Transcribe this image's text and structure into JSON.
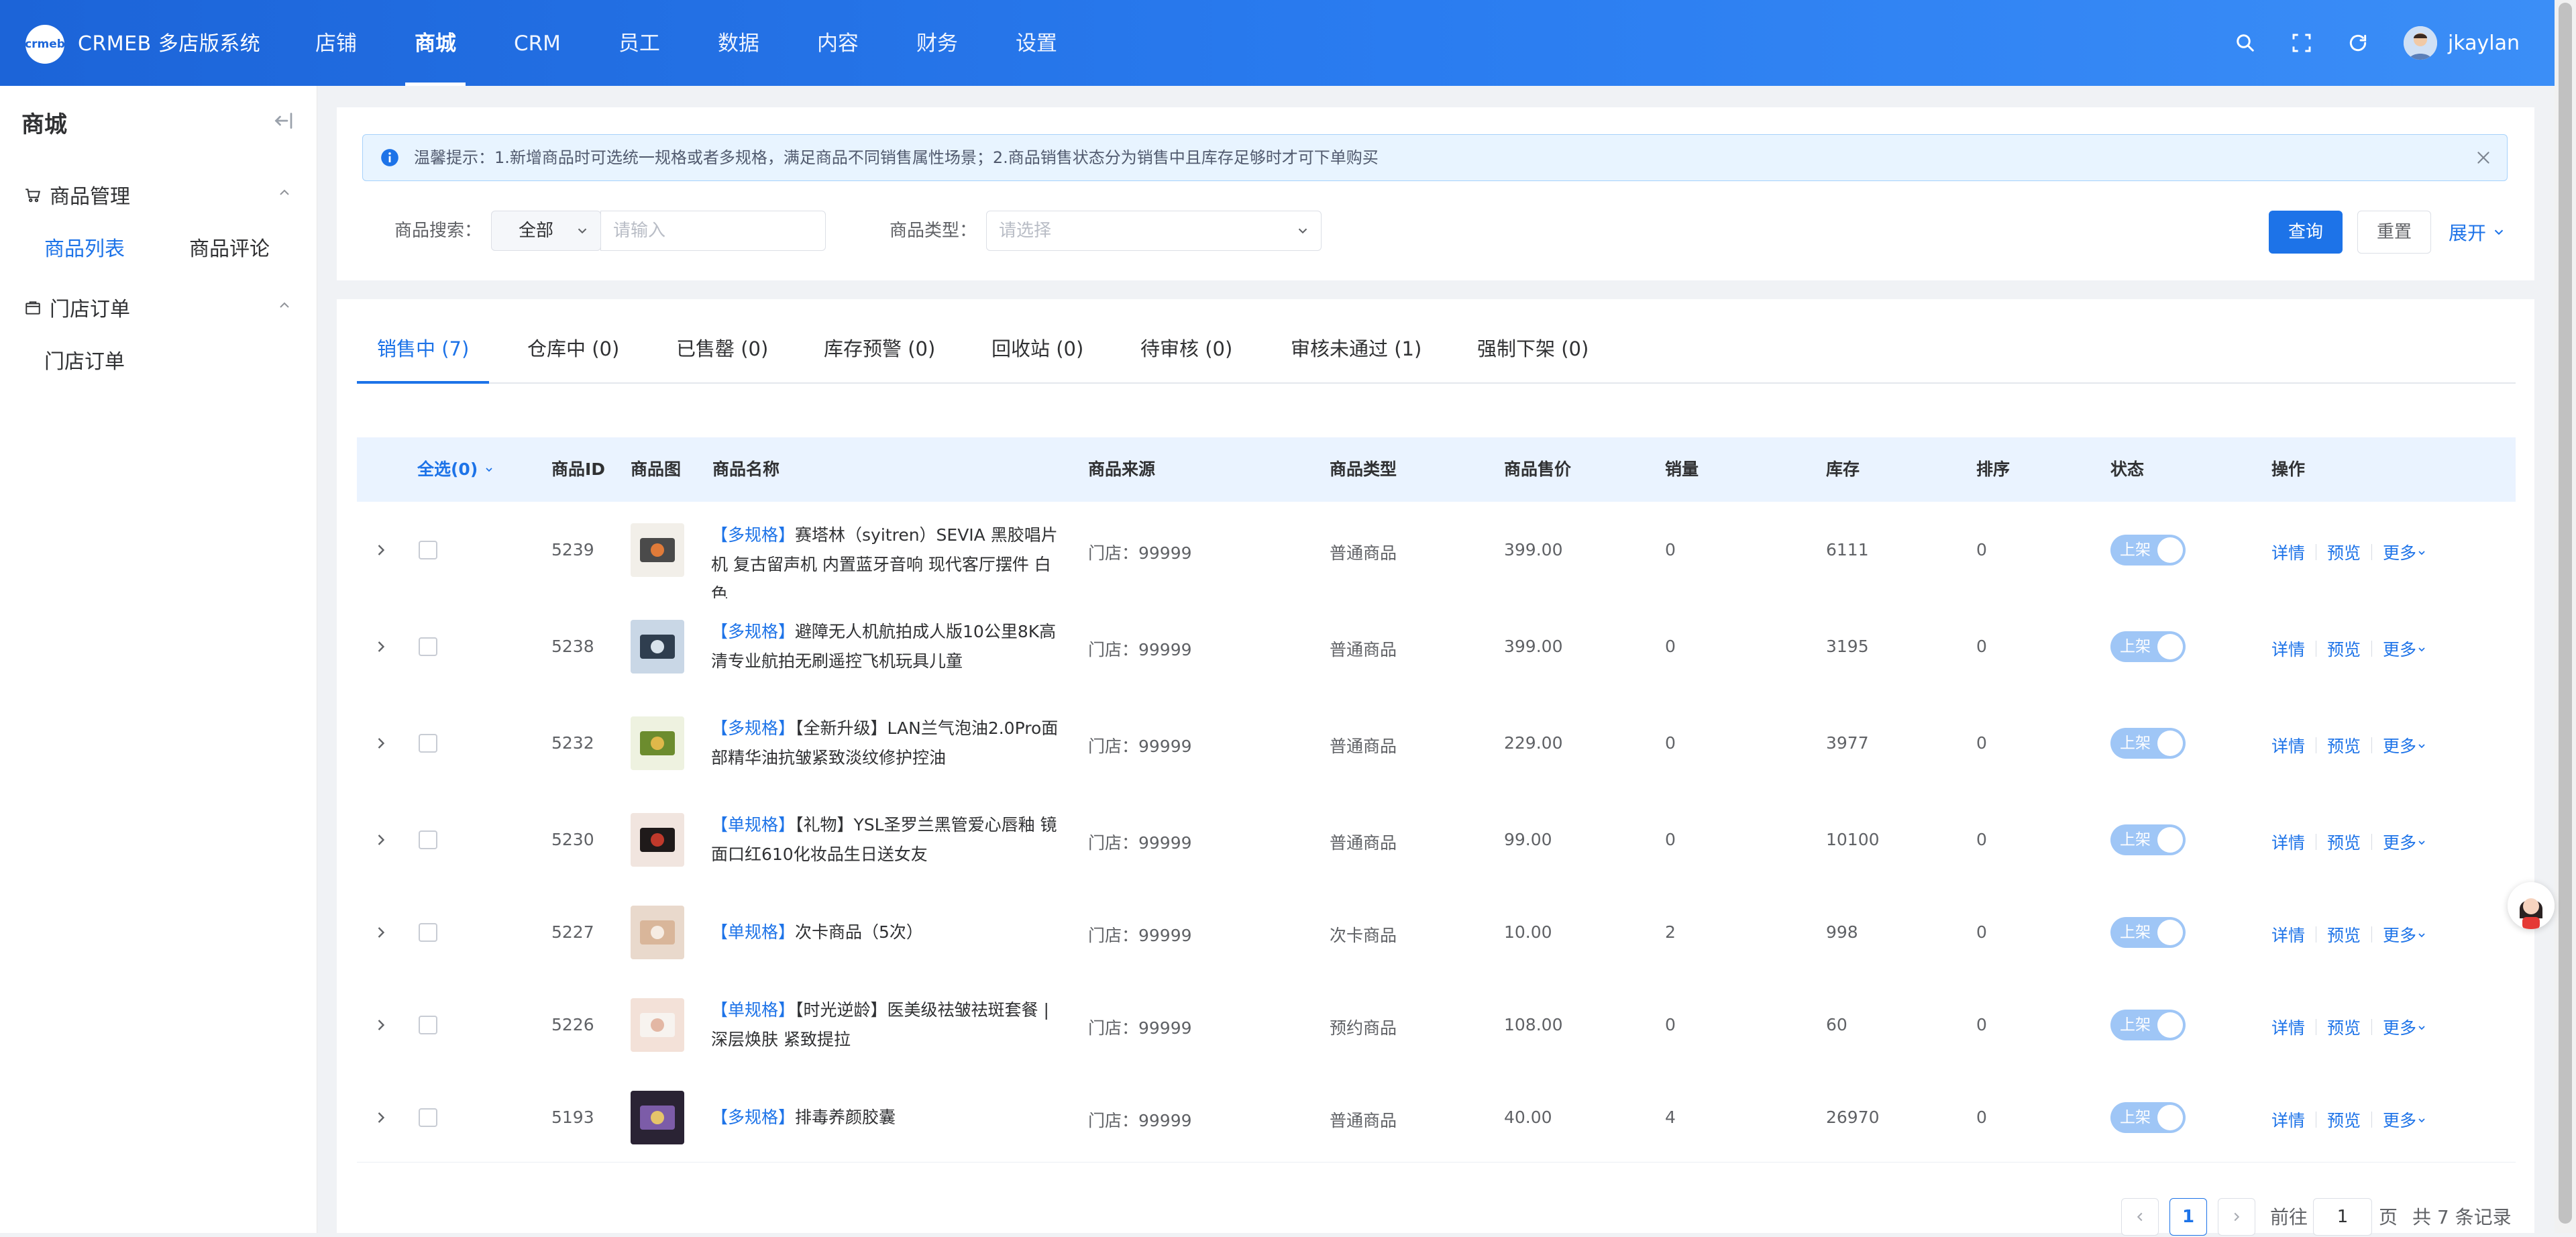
{
  "app": {
    "logo_text": "crmeb",
    "brand": "CRMEB 多店版系统"
  },
  "topnav": [
    {
      "label": "店铺"
    },
    {
      "label": "商城",
      "active": true
    },
    {
      "label": "CRM"
    },
    {
      "label": "员工"
    },
    {
      "label": "数据"
    },
    {
      "label": "内容"
    },
    {
      "label": "财务"
    },
    {
      "label": "设置"
    }
  ],
  "header": {
    "username": "jkaylan",
    "icons": [
      "search-icon",
      "fullscreen-icon",
      "refresh-icon",
      "avatar"
    ]
  },
  "sidebar": {
    "title": "商城",
    "groups": [
      {
        "label": "商品管理",
        "icon": "cart-icon",
        "items": [
          "商品列表",
          "商品评论"
        ]
      },
      {
        "label": "门店订单",
        "icon": "order-icon",
        "items": [
          "门店订单"
        ]
      }
    ]
  },
  "notice": {
    "text": "温馨提示：1.新增商品时可选统一规格或者多规格，满足商品不同销售属性场景；2.商品销售状态分为销售中且库存足够时才可下单购买"
  },
  "filters": {
    "search_label": "商品搜索：",
    "search_scope": "全部",
    "search_placeholder": "请输入",
    "type_label": "商品类型：",
    "type_placeholder": "请选择",
    "query_button": "查询",
    "reset_button": "重置",
    "expand_link": "展开"
  },
  "tabs": [
    {
      "label": "销售中 (7)",
      "active": true
    },
    {
      "label": "仓库中 (0)"
    },
    {
      "label": "已售罄 (0)"
    },
    {
      "label": "库存预警 (0)"
    },
    {
      "label": "回收站 (0)"
    },
    {
      "label": "待审核 (0)"
    },
    {
      "label": "审核未通过 (1)"
    },
    {
      "label": "强制下架 (0)"
    }
  ],
  "table": {
    "headers": {
      "select_all": "全选(0)",
      "id": "商品ID",
      "image": "商品图",
      "name": "商品名称",
      "source": "商品来源",
      "type": "商品类型",
      "price": "商品售价",
      "sales": "销量",
      "stock": "库存",
      "sort": "排序",
      "status": "状态",
      "actions": "操作"
    },
    "action_labels": {
      "detail": "详情",
      "preview": "预览",
      "more": "更多"
    },
    "status_label": "上架",
    "rows": [
      {
        "id": "5239",
        "tag": "【多规格】",
        "name": "赛塔林（syitren）SEVIA 黑胶唱片机 复古留声机 内置蓝牙音响 现代客厅摆件 白色",
        "source": "门店：99999",
        "type": "普通商品",
        "price": "399.00",
        "sales": "0",
        "stock": "6111",
        "sort": "0",
        "on_shelf": true
      },
      {
        "id": "5238",
        "tag": "【多规格】",
        "name": "避障无人机航拍成人版10公里8K高清专业航拍无刷遥控飞机玩具儿童",
        "source": "门店：99999",
        "type": "普通商品",
        "price": "399.00",
        "sales": "0",
        "stock": "3195",
        "sort": "0",
        "on_shelf": true
      },
      {
        "id": "5232",
        "tag": "【多规格】",
        "name": "【全新升级】LAN兰气泡油2.0Pro面部精华油抗皱紧致淡纹修护控油",
        "source": "门店：99999",
        "type": "普通商品",
        "price": "229.00",
        "sales": "0",
        "stock": "3977",
        "sort": "0",
        "on_shelf": true
      },
      {
        "id": "5230",
        "tag": "【单规格】",
        "name": "【礼物】YSL圣罗兰黑管爱心唇釉 镜面口红610化妆品生日送女友",
        "source": "门店：99999",
        "type": "普通商品",
        "price": "99.00",
        "sales": "0",
        "stock": "10100",
        "sort": "0",
        "on_shelf": true
      },
      {
        "id": "5227",
        "tag": "【单规格】",
        "name": "次卡商品（5次）",
        "source": "门店：99999",
        "type": "次卡商品",
        "price": "10.00",
        "sales": "2",
        "stock": "998",
        "sort": "0",
        "on_shelf": true
      },
      {
        "id": "5226",
        "tag": "【单规格】",
        "name": "【时光逆龄】医美级祛皱祛斑套餐 | 深层焕肤 紧致提拉",
        "source": "门店：99999",
        "type": "预约商品",
        "price": "108.00",
        "sales": "0",
        "stock": "60",
        "sort": "0",
        "on_shelf": true
      },
      {
        "id": "5193",
        "tag": "【多规格】",
        "name": "排毒养颜胶囊",
        "source": "门店：99999",
        "type": "普通商品",
        "price": "40.00",
        "sales": "4",
        "stock": "26970",
        "sort": "0",
        "on_shelf": true
      }
    ]
  },
  "pagination": {
    "current_page": "1",
    "goto_label": "前往",
    "goto_value": "1",
    "page_unit": "页",
    "total_text": "共 7 条记录"
  },
  "colors": {
    "primary": "#1d73e8",
    "header_gradient_start": "#1c64d8",
    "header_gradient_end": "#3b8ef7",
    "switch_on": "#9fc6f6",
    "notice_bg": "#e8f4ff"
  }
}
